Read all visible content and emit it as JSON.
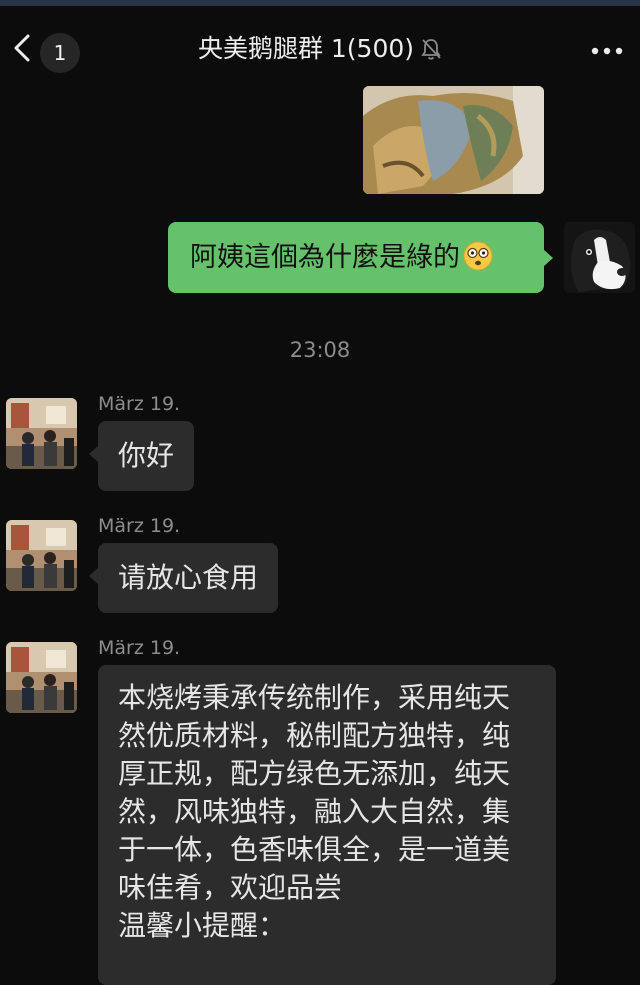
{
  "header": {
    "unread_count": "1",
    "title": "央美鹅腿群 1(500)"
  },
  "outgoing": {
    "text": "阿姨這個為什麼是綠的"
  },
  "divider": {
    "time": "23:08"
  },
  "messages": [
    {
      "sender": "März 19.",
      "text": "你好"
    },
    {
      "sender": "März 19.",
      "text": "请放心食用"
    },
    {
      "sender": "März 19.",
      "lines": [
        "本烧烤秉承传统制作，采用纯天",
        "然优质材料，秘制配方独特，纯",
        "厚正规，配方绿色无添加，纯天",
        "然，风味独特，融入大自然，集",
        "于一体，色香味俱全，是一道美",
        "味佳肴，欢迎品尝",
        "温馨小提醒："
      ]
    }
  ],
  "colors": {
    "background": "#0c0c0c",
    "outgoing_bubble": "#66c26a",
    "incoming_bubble": "#2c2c2c"
  },
  "icons": [
    "back-icon",
    "bell-muted-icon",
    "more-icon",
    "astonished-emoji-icon"
  ]
}
